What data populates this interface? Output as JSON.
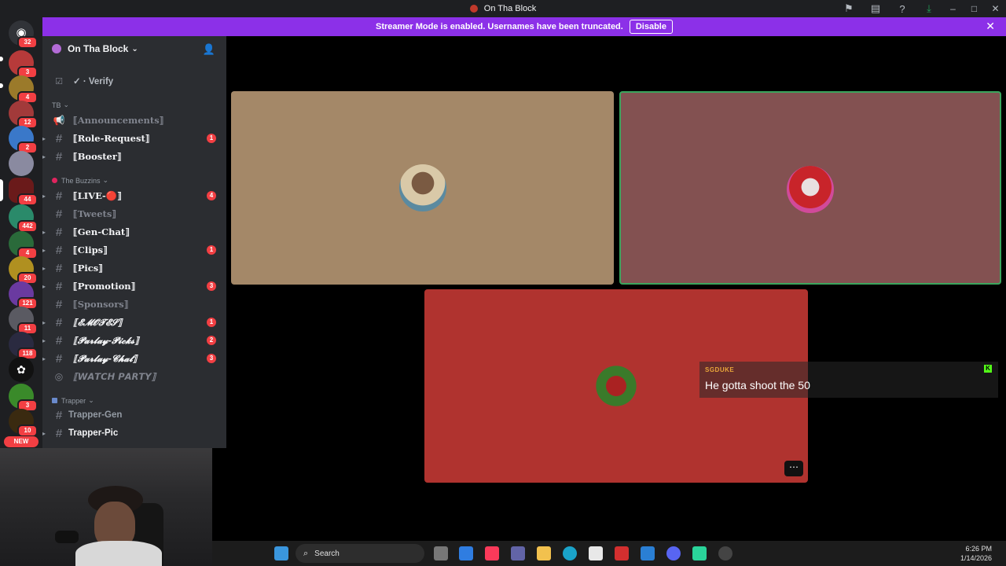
{
  "window": {
    "title": "On Tha Block"
  },
  "banner": {
    "text": "Streamer Mode is enabled. Usernames have been truncated.",
    "disable_label": "Disable"
  },
  "rail": {
    "badges": [
      "32",
      "3",
      "4",
      "12",
      "2",
      "44",
      "442",
      "4",
      "20",
      "121",
      "11",
      "118",
      "3",
      "10"
    ],
    "new_label": "NEW"
  },
  "guild": {
    "name": "On Tha Block"
  },
  "channels": {
    "verify": "✓ · Verify",
    "cat_tb": "TB",
    "announcements": "⟦Announcements⟧",
    "role_request": "⟦Role-Request⟧",
    "role_request_count": "1",
    "booster": "⟦Booster⟧",
    "cat_buzzins": "The Buzzins",
    "live": "⟦LIVE-🔴⟧",
    "live_count": "4",
    "tweets": "⟦Tweets⟧",
    "gen_chat": "⟦Gen-Chat⟧",
    "clips": "⟦Clips⟧",
    "clips_count": "1",
    "pics": "⟦Pics⟧",
    "promotion": "⟦Promotion⟧",
    "promotion_count": "3",
    "sponsors": "⟦Sponsors⟧",
    "emotes": "⟦𝓔𝓜𝓞𝓣𝓔𝓢⟧",
    "emotes_count": "1",
    "parlay_picks": "⟦𝓟𝓪𝓻𝓵𝓪𝔂-𝓟𝓲𝓬𝓴𝓼⟧",
    "parlay_picks_count": "2",
    "parlay_chat": "⟦𝓟𝓪𝓻𝓵𝓪𝔂-𝓒𝓱𝓪𝓽⟧",
    "parlay_chat_count": "3",
    "watch_party": "⟦𝙒𝘼𝙏𝘾𝙃 𝙋𝘼𝙍𝙏𝙔⟧",
    "cat_trapper": "Trapper",
    "trapper_gen": "Trapper-Gen",
    "trapper_pic": "Trapper-Pic"
  },
  "overlay": {
    "username": "SGDUKE",
    "message": "He gotta shoot the 50"
  },
  "taskbar": {
    "search_label": "Search",
    "time": "6:26 PM",
    "date": "1/14/2026"
  },
  "colors": {
    "tile1": "#a48868",
    "tile2": "#835151",
    "tile3": "#b0332f",
    "speaking_border": "#3ba55d",
    "banner": "#8c30e8"
  }
}
